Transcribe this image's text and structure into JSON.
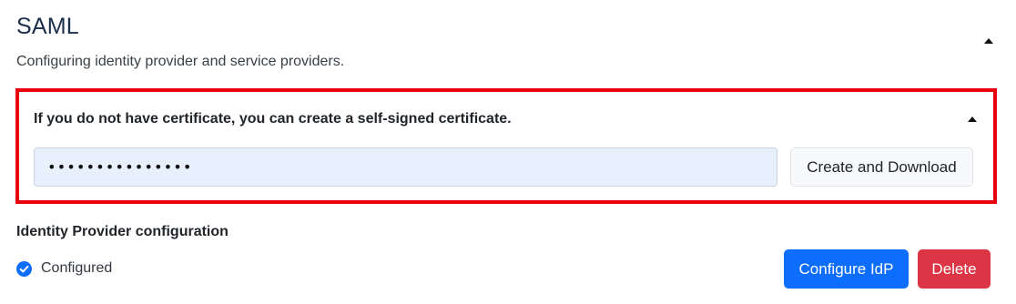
{
  "section": {
    "title": "SAML",
    "subtitle": "Configuring identity provider and service providers.",
    "collapse_icon": "caret-up-icon"
  },
  "certificate": {
    "heading": "If you do not have certificate, you can create a self-signed certificate.",
    "collapse_icon": "caret-up-icon",
    "password_value": "•••••••••••••••",
    "create_button_label": "Create and Download",
    "highlight_color": "#e8000b",
    "input_background": "#e8f0fe"
  },
  "idp": {
    "heading": "Identity Provider configuration",
    "status_icon": "check-circle-icon",
    "status_label": "Configured",
    "status_color": "#0d6efd",
    "configure_button_label": "Configure IdP",
    "delete_button_label": "Delete",
    "configure_color": "#0d6efd",
    "delete_color": "#dc3545"
  }
}
